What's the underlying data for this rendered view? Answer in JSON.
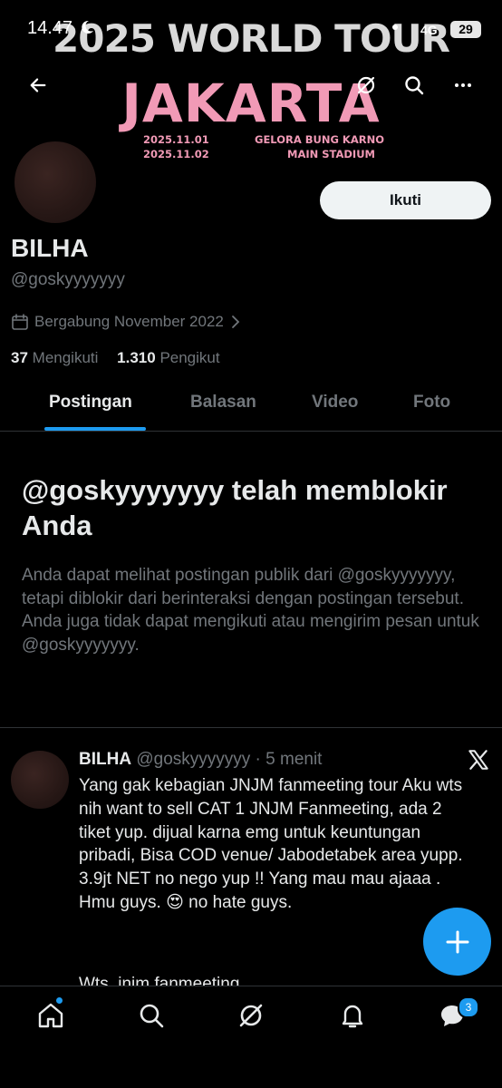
{
  "status_bar": {
    "time": "14.47",
    "network": "4G",
    "battery": "29"
  },
  "banner": {
    "line1": "2025 WORLD TOUR",
    "line2": "JAKARTA",
    "date1": "2025.11.01",
    "date2": "2025.11.02",
    "venue1": "GELORA BUNG KARNO",
    "venue2": "MAIN STADIUM"
  },
  "profile": {
    "follow_label": "Ikuti",
    "display_name": "BILHA",
    "handle": "@goskyyyyyyy",
    "joined": "Bergabung November 2022",
    "following_count": "37",
    "following_label": "Mengikuti",
    "followers_count": "1.310",
    "followers_label": "Pengikut"
  },
  "tabs": [
    {
      "label": "Postingan",
      "active": true
    },
    {
      "label": "Balasan",
      "active": false
    },
    {
      "label": "Video",
      "active": false
    },
    {
      "label": "Foto",
      "active": false
    }
  ],
  "blocked": {
    "title": "@goskyyyyyyy telah memblokir Anda",
    "description": "Anda dapat melihat postingan publik dari @goskyyyyyyy, tetapi diblokir dari berinteraksi dengan postingan tersebut. Anda juga tidak dapat mengikuti atau mengirim pesan untuk @goskyyyyyyy."
  },
  "post": {
    "author": "BILHA",
    "handle": "@goskyyyyyyy",
    "separator": "·",
    "time": "5 menit",
    "text": "Yang gak kebagian JNJM fanmeeting tour Aku wts nih want to sell CAT 1 JNJM Fanmeeting, ada 2 tiket yup. dijual karna emg untuk keuntungan pribadi, Bisa COD venue/ Jabodetabek area yupp.  3.9jt NET no nego yup !! Yang mau mau ajaaa . Hmu guys. 😍 no hate guys.",
    "text_more": "Wts, jnjm fanmeeting"
  },
  "bottom_nav": {
    "messages_badge": "3"
  },
  "colors": {
    "accent": "#1d9bf0",
    "background": "#000000",
    "secondary_text": "#71767b",
    "banner_pink": "#f19ab6"
  }
}
